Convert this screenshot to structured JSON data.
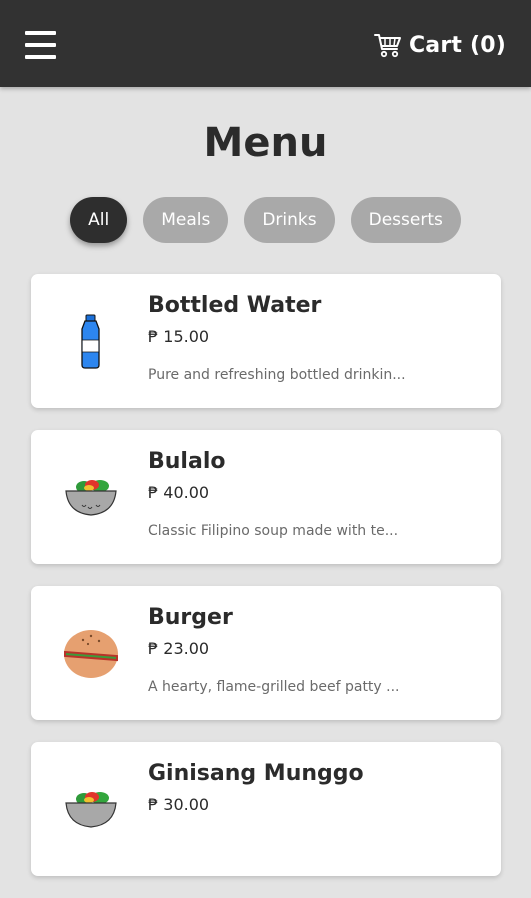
{
  "header": {
    "menu_icon": "hamburger-icon",
    "cart_icon": "shopping-cart-icon",
    "cart_label": "Cart (0)"
  },
  "page": {
    "title": "Menu"
  },
  "filters": [
    {
      "label": "All",
      "active": true
    },
    {
      "label": "Meals",
      "active": false
    },
    {
      "label": "Drinks",
      "active": false
    },
    {
      "label": "Desserts",
      "active": false
    }
  ],
  "items": [
    {
      "name": "Bottled Water",
      "price": "₱ 15.00",
      "description": "Pure and refreshing bottled drinkin...",
      "icon": "bottle-icon"
    },
    {
      "name": "Bulalo",
      "price": "₱ 40.00",
      "description": "Classic Filipino soup made with te...",
      "icon": "soup-bowl-icon"
    },
    {
      "name": "Burger",
      "price": "₱ 23.00",
      "description": "A hearty, flame-grilled beef patty ...",
      "icon": "burger-icon"
    },
    {
      "name": "Ginisang Munggo",
      "price": "₱ 30.00",
      "description": "",
      "icon": "soup-bowl-icon"
    }
  ],
  "colors": {
    "header_bg": "#323232",
    "page_bg": "#e3e3e3",
    "chip_active": "#2e2e2e",
    "chip_inactive": "#a9a9a9"
  }
}
